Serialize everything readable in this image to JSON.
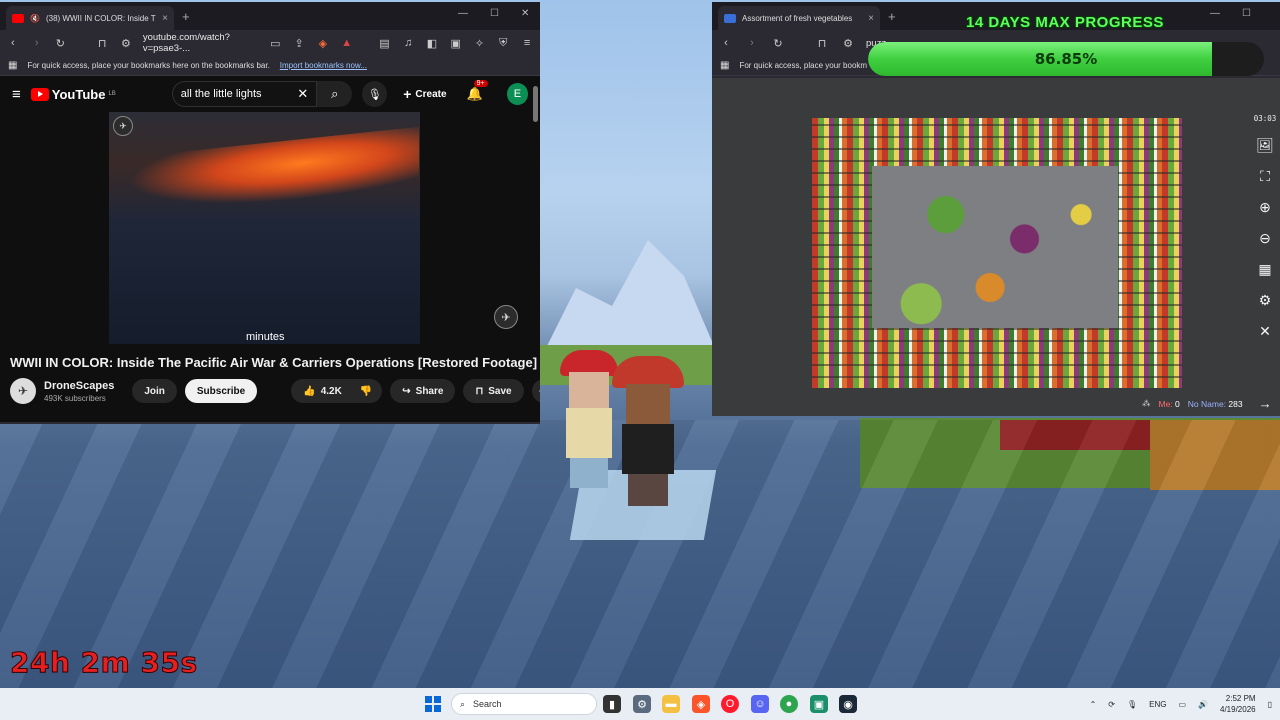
{
  "colors": {
    "accent_green": "#5cff5c",
    "timer_red": "#e62020",
    "youtube_red": "#ff0000"
  },
  "overlay": {
    "progress_title": "14 DAYS MAX PROGRESS",
    "progress_percent": "86.85%",
    "progress_value": 0.8685,
    "stream_timer": "24h 2m 35s"
  },
  "left_browser": {
    "tab_title": "(38) WWII IN COLOR: Inside T",
    "url": "youtube.com/watch?v=psae3-...",
    "bookmarks_prompt": "For quick access, place your bookmarks here on the bookmarks bar.",
    "import_link": "Import bookmarks now...",
    "youtube": {
      "logo_text": "YouTube",
      "logo_sup": "LB",
      "search_value": "all the little lights",
      "create_label": "Create",
      "notification_badge": "9+",
      "avatar_letter": "E",
      "caption": "minutes",
      "video_title": "WWII IN COLOR: Inside The Pacific Air War & Carriers Operations [Restored Footage]",
      "channel_name": "DroneScapes",
      "subscribers": "493K subscribers",
      "join_label": "Join",
      "subscribe_label": "Subscribe",
      "likes": "4.2K",
      "share_label": "Share",
      "save_label": "Save"
    }
  },
  "right_browser": {
    "tab_title": "Assortment of fresh vegetables",
    "url": "puzz",
    "bookmarks_prompt": "For quick access, place your bookm",
    "puzzle": {
      "timer": "03:03",
      "me_label": "Me:",
      "me_count": "0",
      "noname_label": "No Name:",
      "noname_count": "283"
    }
  },
  "taskbar": {
    "search_label": "Search",
    "lang": "ENG",
    "time": "2:52 PM",
    "date": "4/19/2026",
    "apps": [
      "file-explorer-icon",
      "settings-icon",
      "folder-icon",
      "brave-icon",
      "opera-icon",
      "discord-icon",
      "chrome-icon",
      "app-icon",
      "steam-icon"
    ]
  }
}
